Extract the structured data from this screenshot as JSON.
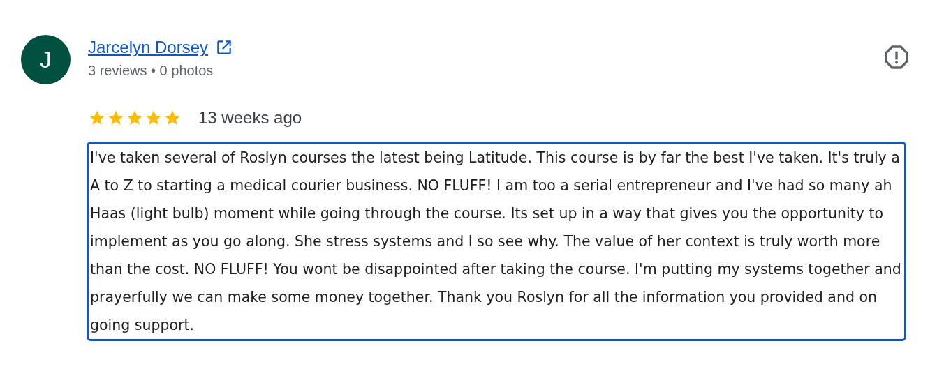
{
  "reviewer": {
    "initial": "J",
    "name": "Jarcelyn Dorsey",
    "meta": "3 reviews • 0 photos"
  },
  "review": {
    "stars": 5,
    "time": "13 weeks ago",
    "focused": true,
    "text": "I've taken several of Roslyn courses the latest being Latitude. This course is by far the best I've taken. It's truly a A to Z to starting a medical courier business. NO FLUFF! I am too a serial entrepreneur and I've had so many ah Haas (light bulb) moment while going through the course. Its set up in a way that gives you the opportunity to implement as you go along. She stress systems and I so see why. The value of her context is truly worth more than the cost. NO FLUFF! You wont be disappointed after taking the course. I'm putting my systems together and prayerfully we can make some money together. Thank you Roslyn for all the information you provided and on going support."
  }
}
